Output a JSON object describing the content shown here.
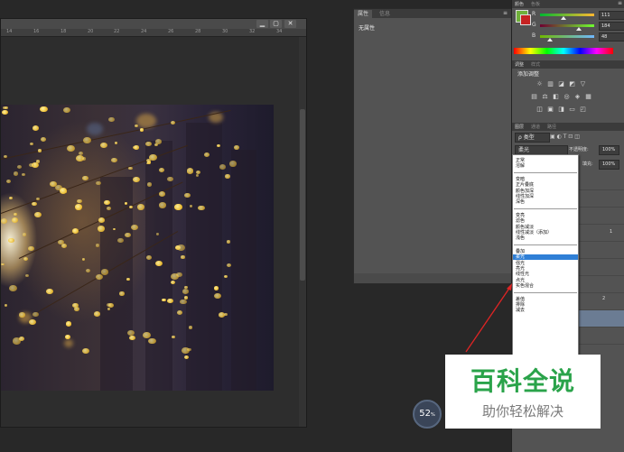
{
  "document": {
    "ruler_ticks": [
      "14",
      "16",
      "18",
      "20",
      "22",
      "24",
      "26",
      "28",
      "30",
      "32",
      "34"
    ],
    "window_buttons": [
      "▁",
      "▢",
      "✕"
    ]
  },
  "properties_panel": {
    "tabs": [
      "属性",
      "信息"
    ],
    "menu_icon": "≡",
    "empty_text": "无属性"
  },
  "color_panel": {
    "tabs": [
      "颜色",
      "色板"
    ],
    "menu_icon": "≡",
    "foreground_color": "#6fb03a",
    "background_color": "#c62222",
    "sliders": [
      {
        "label": "R",
        "value": "111",
        "fraction": 0.44
      },
      {
        "label": "G",
        "value": "184",
        "fraction": 0.72
      },
      {
        "label": "B",
        "value": "48",
        "fraction": 0.19
      }
    ]
  },
  "adjustments_panel": {
    "tabs": [
      "调整",
      "样式"
    ],
    "title": "添加调整",
    "icons": [
      "brightness-icon",
      "levels-icon",
      "curves-icon",
      "exposure-icon",
      "vibrance-icon",
      "hue-icon",
      "color-balance-icon",
      "bw-icon",
      "photo-filter-icon",
      "channel-mixer-icon",
      "color-lookup-icon",
      "invert-icon",
      "posterize-icon",
      "threshold-icon",
      "gradient-map-icon",
      "selective-color-icon"
    ]
  },
  "layers_panel": {
    "tabs": [
      "图层",
      "通道",
      "路径"
    ],
    "filter_label": "ρ 类型",
    "blend_mode": "柔光",
    "opacity_label": "不透明度:",
    "opacity_value": "100%",
    "fill_label": "填充:",
    "fill_value": "100%",
    "visible_row_labels": [
      "1",
      "2"
    ]
  },
  "blend_dropdown": {
    "groups": [
      [
        "正常",
        "溶解"
      ],
      [
        "变暗",
        "正片叠底",
        "颜色加深",
        "线性加深",
        "深色"
      ],
      [
        "变亮",
        "滤色",
        "颜色减淡",
        "线性减淡（添加）",
        "浅色"
      ],
      [
        "叠加",
        "柔光",
        "强光",
        "亮光",
        "线性光",
        "点光",
        "实色混合"
      ],
      [
        "差值",
        "排除",
        "减去"
      ]
    ],
    "highlighted": "柔光"
  },
  "zoom": {
    "value": "52",
    "unit": "%"
  },
  "watermark": {
    "title": "百科全说",
    "subtitle": "助你轻松解决"
  }
}
